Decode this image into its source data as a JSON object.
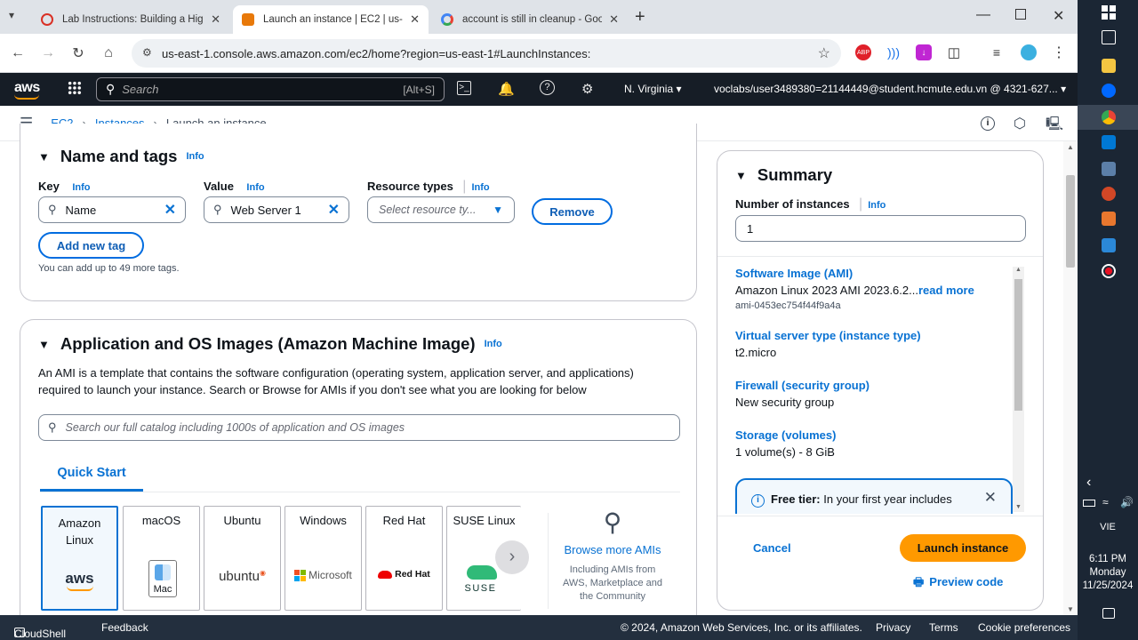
{
  "browser": {
    "tabs": [
      {
        "title": "Lab Instructions: Building a Hig",
        "active": false
      },
      {
        "title": "Launch an instance | EC2 | us-e",
        "active": true
      },
      {
        "title": "account is still in cleanup - Goo",
        "active": false
      }
    ],
    "url": "us-east-1.console.aws.amazon.com/ec2/home?region=us-east-1#LaunchInstances:"
  },
  "aws_nav": {
    "logo": "aws",
    "search_placeholder": "Search",
    "search_shortcut": "[Alt+S]",
    "region": "N. Virginia",
    "account": "voclabs/user3489380=21144449@student.hcmute.edu.vn @ 4321-627..."
  },
  "breadcrumb": [
    "EC2",
    "Instances",
    "Launch an instance"
  ],
  "name_tags": {
    "title": "Name and tags",
    "info": "Info",
    "key_label": "Key",
    "value_label": "Value",
    "resource_label": "Resource types",
    "key_value": "Name",
    "value_value": "Web Server 1",
    "resource_placeholder": "Select resource ty...",
    "remove_label": "Remove",
    "add_tag_label": "Add new tag",
    "help_text": "You can add up to 49 more tags."
  },
  "ami": {
    "title": "Application and OS Images (Amazon Machine Image)",
    "info": "Info",
    "description": "An AMI is a template that contains the software configuration (operating system, application server, and applications) required to launch your instance. Search or Browse for AMIs if you don't see what you are looking for below",
    "search_placeholder": "Search our full catalog including 1000s of application and OS images",
    "tab": "Quick Start",
    "cards": [
      {
        "name": "Amazon Linux",
        "logo": "aws"
      },
      {
        "name": "macOS",
        "logo": "Mac"
      },
      {
        "name": "Ubuntu",
        "logo": "ubuntu"
      },
      {
        "name": "Windows",
        "logo": "Microsoft"
      },
      {
        "name": "Red Hat",
        "logo": "Red Hat"
      },
      {
        "name": "SUSE Linux",
        "logo": "SUSE"
      }
    ],
    "browse_label": "Browse more AMIs",
    "browse_sub": "Including AMIs from AWS, Marketplace and the Community"
  },
  "summary": {
    "title": "Summary",
    "instances_label": "Number of instances",
    "info": "Info",
    "instances_value": "1",
    "ami_label": "Software Image (AMI)",
    "ami_value": "Amazon Linux 2023 AMI 2023.6.2...",
    "read_more": "read more",
    "ami_id": "ami-0453ec754f44f9a4a",
    "type_label": "Virtual server type (instance type)",
    "type_value": "t2.micro",
    "firewall_label": "Firewall (security group)",
    "firewall_value": "New security group",
    "storage_label": "Storage (volumes)",
    "storage_value": "1 volume(s) - 8 GiB",
    "free_tier_bold": "Free tier:",
    "free_tier_text": " In your first year includes",
    "cancel_label": "Cancel",
    "launch_label": "Launch instance",
    "preview_label": "Preview code"
  },
  "footer": {
    "cloudshell": "CloudShell",
    "feedback": "Feedback",
    "copyright": "© 2024, Amazon Web Services, Inc. or its affiliates.",
    "privacy": "Privacy",
    "terms": "Terms",
    "cookies": "Cookie preferences"
  },
  "taskbar": {
    "lang": "VIE",
    "time": "6:11 PM",
    "day": "Monday",
    "date": "11/25/2024"
  },
  "colors": {
    "aws_nav": "#161d26",
    "link": "#0972d3",
    "launch": "#ff9900",
    "footer": "#232f3e"
  }
}
